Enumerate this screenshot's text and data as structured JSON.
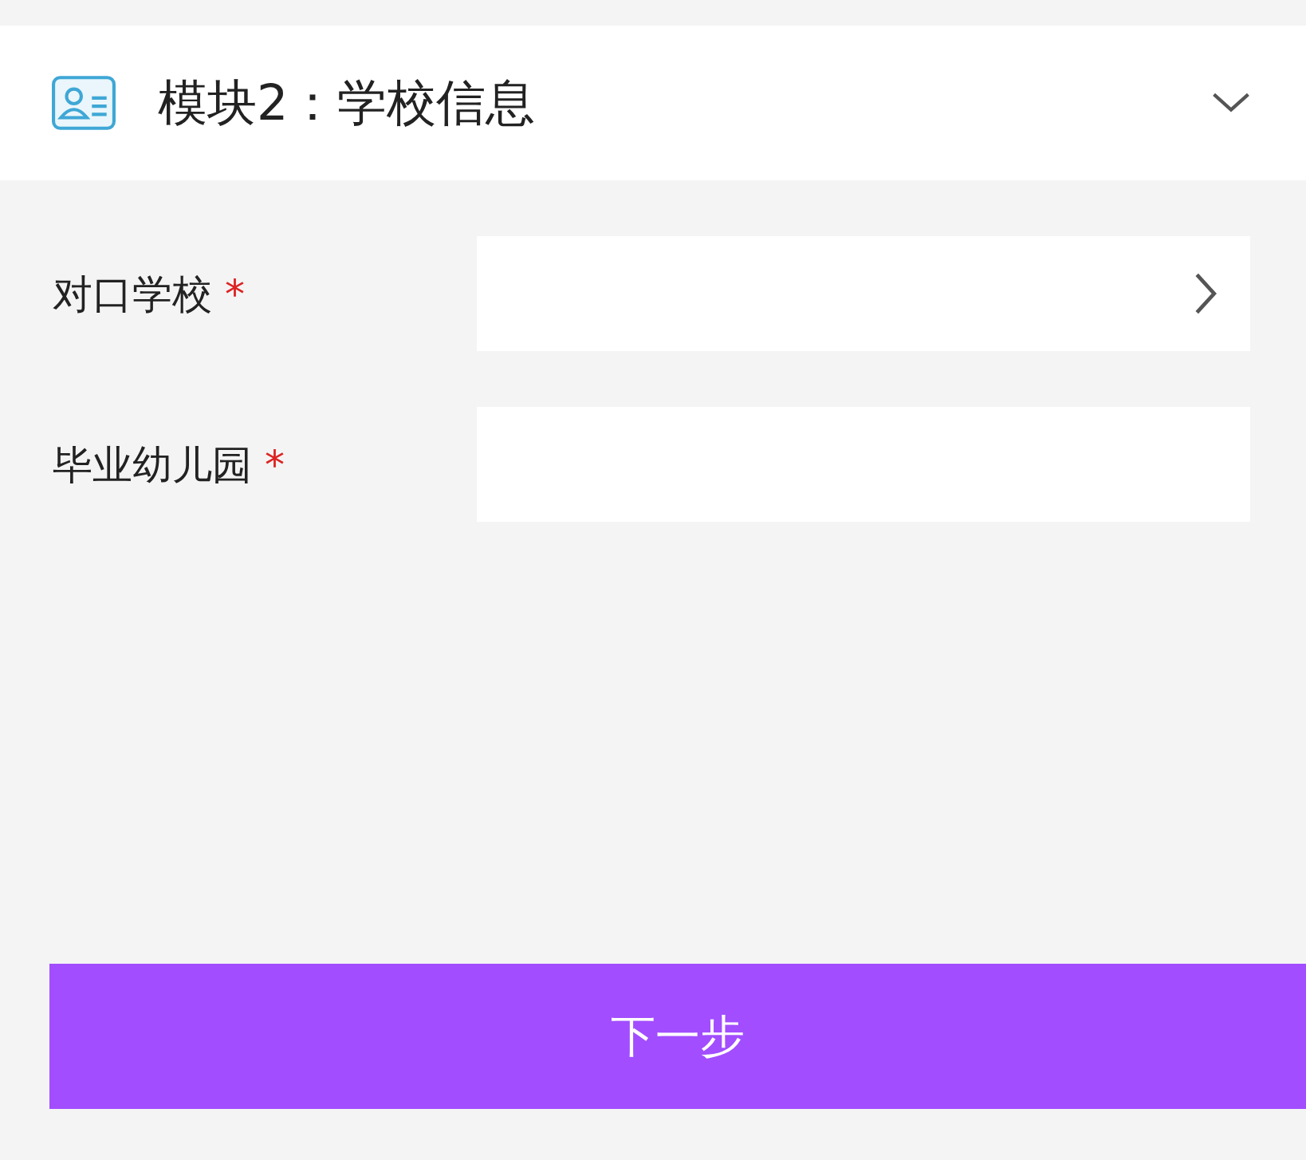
{
  "section": {
    "title": "模块2：学校信息",
    "expanded": true
  },
  "fields": [
    {
      "label": "对口学校",
      "required_mark": "*",
      "kind": "select"
    },
    {
      "label": "毕业幼儿园",
      "required_mark": "*",
      "kind": "input"
    }
  ],
  "next_button": "下一步"
}
